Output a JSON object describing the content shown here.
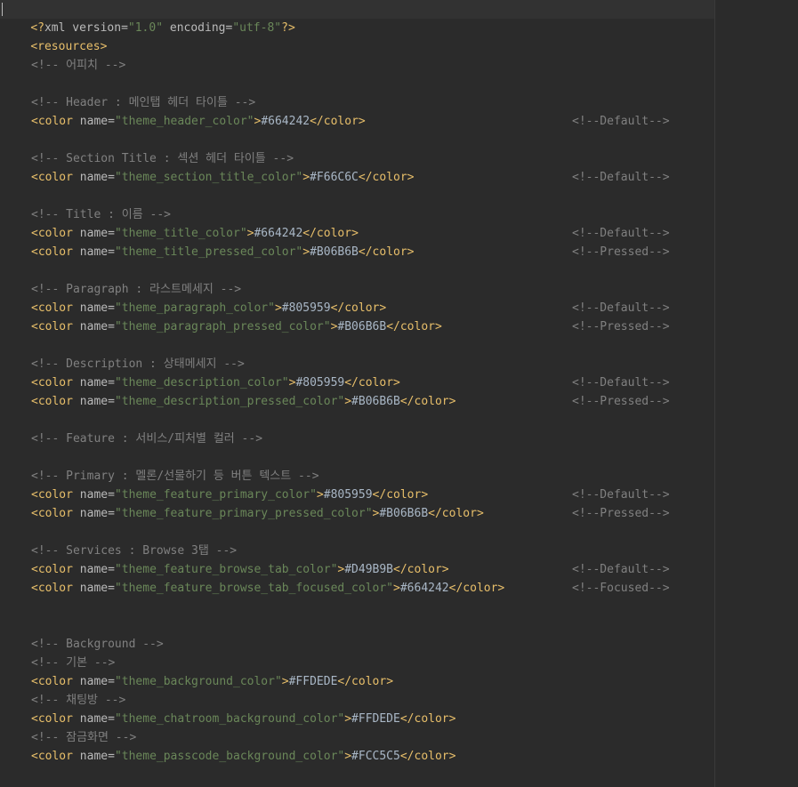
{
  "header": {
    "pi_open": "<?",
    "pi_name": "xml",
    "pi_attr1": " version=",
    "pi_val1": "\"1.0\"",
    "pi_attr2": " encoding=",
    "pi_val2": "\"utf-8\"",
    "pi_close": "?>",
    "resources_tag": "<resources>"
  },
  "comments": {
    "c1": "<!-- 어피치 -->",
    "c2": "<!-- Header : 메인탭 헤더 타이틀 -->",
    "c3": "<!-- Section Title : 섹션 헤더 타이틀 -->",
    "c4": "<!-- Title : 이름 -->",
    "c5": "<!-- Paragraph : 라스트메세지 -->",
    "c6": "<!-- Description : 상태메세지 -->",
    "c7": "<!-- Feature : 서비스/피처별 컬러 -->",
    "c8": "<!-- Primary : 멜론/선물하기 등 버튼 텍스트 -->",
    "c9": "<!-- Services : Browse 3탭 -->",
    "c10": "<!-- Background -->",
    "c11": "<!-- 기본 -->",
    "c12": "<!-- 채팅방 -->",
    "c13": "<!-- 잠금화면 -->"
  },
  "syntax": {
    "color_open": "<color",
    "name_attr": " name=",
    "gt": ">",
    "color_close": "</color>"
  },
  "colors": [
    {
      "name": "\"theme_header_color\"",
      "value": "#664242",
      "note": "<!--Default-->"
    },
    {
      "name": "\"theme_section_title_color\"",
      "value": "#F66C6C",
      "note": "<!--Default-->"
    },
    {
      "name": "\"theme_title_color\"",
      "value": "#664242",
      "note": "<!--Default-->"
    },
    {
      "name": "\"theme_title_pressed_color\"",
      "value": "#B06B6B",
      "note": "<!--Pressed-->"
    },
    {
      "name": "\"theme_paragraph_color\"",
      "value": "#805959",
      "note": "<!--Default-->"
    },
    {
      "name": "\"theme_paragraph_pressed_color\"",
      "value": "#B06B6B",
      "note": "<!--Pressed-->"
    },
    {
      "name": "\"theme_description_color\"",
      "value": "#805959",
      "note": "<!--Default-->"
    },
    {
      "name": "\"theme_description_pressed_color\"",
      "value": "#B06B6B",
      "note": "<!--Pressed-->"
    },
    {
      "name": "\"theme_feature_primary_color\"",
      "value": "#805959",
      "note": "<!--Default-->"
    },
    {
      "name": "\"theme_feature_primary_pressed_color\"",
      "value": "#B06B6B",
      "note": "<!--Pressed-->"
    },
    {
      "name": "\"theme_feature_browse_tab_color\"",
      "value": "#D49B9B",
      "note": "<!--Default-->"
    },
    {
      "name": "\"theme_feature_browse_tab_focused_color\"",
      "value": "#664242",
      "note": "<!--Focused-->"
    },
    {
      "name": "\"theme_background_color\"",
      "value": "#FFDEDE",
      "note": ""
    },
    {
      "name": "\"theme_chatroom_background_color\"",
      "value": "#FFDEDE",
      "note": ""
    },
    {
      "name": "\"theme_passcode_background_color\"",
      "value": "#FCC5C5",
      "note": ""
    }
  ],
  "theme": {
    "background": "#2b2b2b",
    "tag_color": "#e8bf6a",
    "attr_value_color": "#6a8759",
    "comment_color": "#808080",
    "text_color": "#a9b7c6"
  }
}
